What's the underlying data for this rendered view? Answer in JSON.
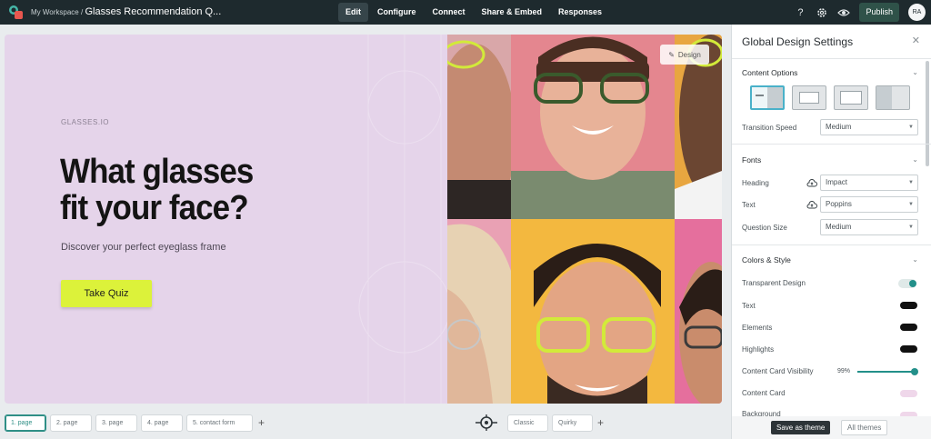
{
  "topbar": {
    "workspace": "My Workspace",
    "separator": "/",
    "project_title": "Glasses Recommendation Q...",
    "nav": [
      "Edit",
      "Configure",
      "Connect",
      "Share & Embed",
      "Responses"
    ],
    "active_nav": "Edit",
    "publish_label": "Publish",
    "avatar_initials": "RA"
  },
  "canvas": {
    "brand": "GLASSES.IO",
    "headline_line1": "What glasses",
    "headline_line2": "fit your face?",
    "subheadline": "Discover your perfect eyeglass frame",
    "cta_label": "Take Quiz",
    "design_button_label": "Design",
    "background_color": "#e5d4ea",
    "cta_color": "#dcf23a"
  },
  "pages": [
    "1. page",
    "2. page",
    "3. page",
    "4. page",
    "5. contact form"
  ],
  "active_page": "1. page",
  "themes": [
    "Classic",
    "Quirky"
  ],
  "panel": {
    "title": "Global Design Settings",
    "content_options": {
      "header": "Content Options",
      "transition_label": "Transition Speed",
      "transition_value": "Medium"
    },
    "fonts": {
      "header": "Fonts",
      "heading_label": "Heading",
      "heading_value": "Impact",
      "text_label": "Text",
      "text_value": "Poppins",
      "question_size_label": "Question Size",
      "question_size_value": "Medium"
    },
    "colors": {
      "header": "Colors & Style",
      "transparent_label": "Transparent Design",
      "transparent_on": true,
      "text_label": "Text",
      "text_color": "#111111",
      "elements_label": "Elements",
      "elements_color": "#111111",
      "highlights_label": "Highlights",
      "highlights_color": "#111111",
      "card_visibility_label": "Content Card Visibility",
      "card_visibility_value": "99%",
      "content_card_label": "Content Card",
      "content_card_color": "#efd7ea",
      "background_label": "Background",
      "background_color": "#efd7ea"
    },
    "save_theme_label": "Save as theme",
    "all_themes_label": "All themes"
  }
}
